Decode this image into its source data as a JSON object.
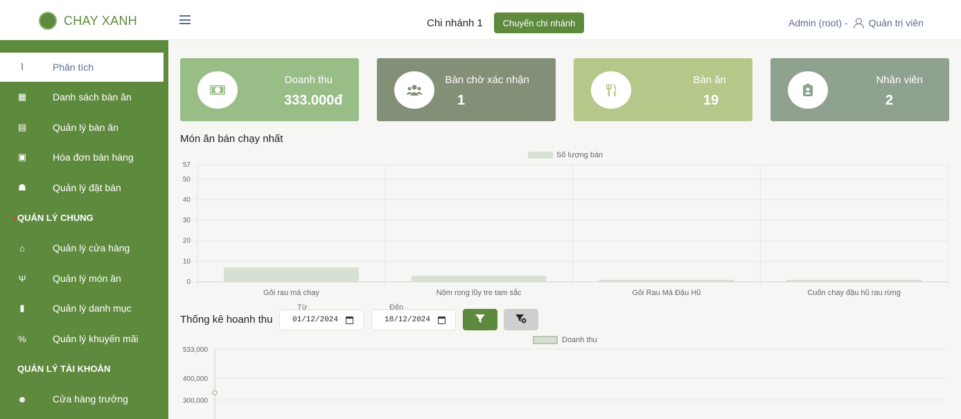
{
  "brand": {
    "name": "CHAY XANH",
    "logo_text": "CHAY XANH"
  },
  "header": {
    "branch_name": "Chi nhánh 1",
    "switch_branch_label": "Chuyển chi nhánh",
    "user_text": "Admin (root) -",
    "role_text": "Quản trị viên"
  },
  "sidebar": {
    "items_top": [
      {
        "label": "Phân tích",
        "icon": "chart-line-icon",
        "glyph": "⌇"
      },
      {
        "label": "Danh sách bàn ăn",
        "icon": "table-grid-icon",
        "glyph": "▦"
      },
      {
        "label": "Quản lý bàn ăn",
        "icon": "list-icon",
        "glyph": "▤"
      },
      {
        "label": "Hóa đơn bán hàng",
        "icon": "money-bill-icon",
        "glyph": "▣"
      },
      {
        "label": "Quản lý đặt bàn",
        "icon": "people-table-icon",
        "glyph": "☗"
      }
    ],
    "section_general": "QUẢN LÝ CHUNG",
    "items_general": [
      {
        "label": "Quản lý cửa hàng",
        "icon": "store-icon",
        "glyph": "⌂"
      },
      {
        "label": "Quản lý món ăn",
        "icon": "utensils-icon",
        "glyph": "Ψ"
      },
      {
        "label": "Quản lý danh mục",
        "icon": "clipboard-icon",
        "glyph": "▮"
      },
      {
        "label": "Quản lý khuyến mãi",
        "icon": "percent-icon",
        "glyph": "%"
      }
    ],
    "section_account": "QUẢN LÝ TÀI KHOẢN",
    "items_account": [
      {
        "label": "Cửa hàng trưởng",
        "icon": "user-tie-icon",
        "glyph": "☻"
      }
    ]
  },
  "cards": [
    {
      "title": "Doanh thu",
      "value": "333.000đ",
      "icon": "money-icon",
      "glyph": "▣",
      "color": "#99bd86"
    },
    {
      "title": "Bàn chờ xác nhận",
      "value": "1",
      "icon": "users-icon",
      "glyph": "☻",
      "color": "#848f78"
    },
    {
      "title": "Bàn ăn",
      "value": "19",
      "icon": "utensils-icon",
      "glyph": "Ψ",
      "color": "#b6c889"
    },
    {
      "title": "Nhân viên",
      "value": "2",
      "icon": "id-badge-icon",
      "glyph": "▮",
      "color": "#8fa290"
    }
  ],
  "best_sellers": {
    "title": "Món ăn bán chạy nhất",
    "chart_data": {
      "type": "bar",
      "categories": [
        "Gỏi rau má chay",
        "Nộm rong lũy tre tam sắc",
        "Gỏi Rau Má Đậu Hũ",
        "Cuốn chay đậu hũ rau rừng"
      ],
      "series": [
        {
          "name": "Số lượng bán",
          "values": [
            7,
            3,
            1,
            1
          ]
        }
      ],
      "yticks": [
        "57",
        "50",
        "40",
        "30",
        "20",
        "10",
        "0"
      ],
      "ylim": [
        0,
        57
      ],
      "color": "#d8e0d4",
      "grid": true,
      "legend": "top-center"
    }
  },
  "revenue": {
    "title": "Thống kê hoanh thu",
    "from_label": "Từ",
    "from_value": "01/12/2024",
    "to_label": "Đến",
    "to_value": "18/12/2024",
    "filter_icon": "filter-icon",
    "clear_filter_icon": "filter-clear-icon",
    "chart_data": {
      "type": "line",
      "series": [
        {
          "name": "Doanh thu",
          "values": [
            333000
          ]
        }
      ],
      "yticks": [
        "533,000",
        "400,000",
        "300,000"
      ],
      "color": "#c5d4bd",
      "legend": "top-center"
    }
  }
}
